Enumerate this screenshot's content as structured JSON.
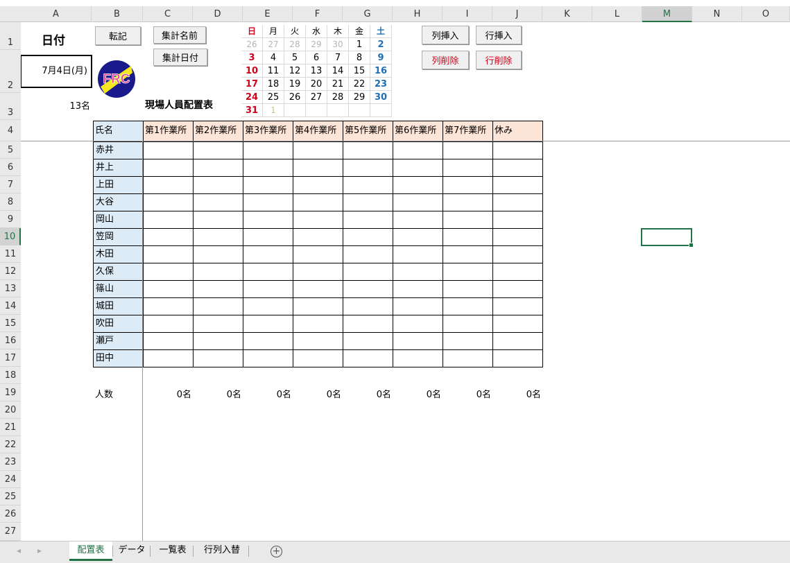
{
  "columns": [
    "A",
    "B",
    "C",
    "D",
    "E",
    "F",
    "G",
    "H",
    "I",
    "J",
    "K",
    "L",
    "M",
    "N",
    "O"
  ],
  "rows": [
    "1",
    "2",
    "3",
    "4",
    "5",
    "6",
    "7",
    "8",
    "9",
    "10",
    "11",
    "12",
    "13",
    "14",
    "15",
    "16",
    "17",
    "18",
    "19",
    "20",
    "21",
    "22",
    "23",
    "24",
    "25",
    "26",
    "27"
  ],
  "header": {
    "date_label": "日付",
    "date_value": "7月4日(月)",
    "total_count": "13名",
    "title": "現場人員配置表"
  },
  "buttons": {
    "transfer": "転記",
    "sum_name": "集計名前",
    "sum_date": "集計日付",
    "col_insert": "列挿入",
    "row_insert": "行挿入",
    "col_delete": "列削除",
    "row_delete": "行削除"
  },
  "logo": {
    "text": "FRC",
    "colors": {
      "ring": "#1a1a8c",
      "yellow": "#f5e71f",
      "text": "#e8368f"
    }
  },
  "calendar": {
    "weekdays": [
      "日",
      "月",
      "火",
      "水",
      "木",
      "金",
      "土"
    ],
    "weeks": [
      [
        {
          "d": "26",
          "t": "gray"
        },
        {
          "d": "27",
          "t": "gray"
        },
        {
          "d": "28",
          "t": "gray"
        },
        {
          "d": "29",
          "t": "gray"
        },
        {
          "d": "30",
          "t": "gray"
        },
        {
          "d": "1",
          "t": "n"
        },
        {
          "d": "2",
          "t": "sat"
        }
      ],
      [
        {
          "d": "3",
          "t": "sun"
        },
        {
          "d": "4",
          "t": "n"
        },
        {
          "d": "5",
          "t": "n"
        },
        {
          "d": "6",
          "t": "n"
        },
        {
          "d": "7",
          "t": "n"
        },
        {
          "d": "8",
          "t": "n"
        },
        {
          "d": "9",
          "t": "sat"
        }
      ],
      [
        {
          "d": "10",
          "t": "sun"
        },
        {
          "d": "11",
          "t": "n"
        },
        {
          "d": "12",
          "t": "n"
        },
        {
          "d": "13",
          "t": "n"
        },
        {
          "d": "14",
          "t": "n"
        },
        {
          "d": "15",
          "t": "n"
        },
        {
          "d": "16",
          "t": "sat"
        }
      ],
      [
        {
          "d": "17",
          "t": "sun"
        },
        {
          "d": "18",
          "t": "n"
        },
        {
          "d": "19",
          "t": "n"
        },
        {
          "d": "20",
          "t": "n"
        },
        {
          "d": "21",
          "t": "n"
        },
        {
          "d": "22",
          "t": "n"
        },
        {
          "d": "23",
          "t": "sat"
        }
      ],
      [
        {
          "d": "24",
          "t": "sun"
        },
        {
          "d": "25",
          "t": "n"
        },
        {
          "d": "26",
          "t": "n"
        },
        {
          "d": "27",
          "t": "n"
        },
        {
          "d": "28",
          "t": "n"
        },
        {
          "d": "29",
          "t": "n"
        },
        {
          "d": "30",
          "t": "sat"
        }
      ],
      [
        {
          "d": "31",
          "t": "sun"
        },
        {
          "d": "1",
          "t": "next"
        },
        {
          "d": "",
          "t": "n"
        },
        {
          "d": "",
          "t": "n"
        },
        {
          "d": "",
          "t": "n"
        },
        {
          "d": "",
          "t": "n"
        },
        {
          "d": "",
          "t": "n"
        }
      ]
    ],
    "colors": {
      "sun": "#d0021b",
      "sat": "#1f6fb5",
      "gray": "#b5b5b5",
      "next": "#c9c38a"
    }
  },
  "table": {
    "name_header": "氏名",
    "site_headers": [
      "第1作業所",
      "第2作業所",
      "第3作業所",
      "第4作業所",
      "第5作業所",
      "第6作業所",
      "第7作業所",
      "休み"
    ],
    "names": [
      "赤井",
      "井上",
      "上田",
      "大谷",
      "岡山",
      "笠岡",
      "木田",
      "久保",
      "篠山",
      "城田",
      "吹田",
      "瀬戸",
      "田中"
    ],
    "count_label": "人数",
    "counts": [
      "0名",
      "0名",
      "0名",
      "0名",
      "0名",
      "0名",
      "0名",
      "0名"
    ]
  },
  "sheet_tabs": [
    "配置表",
    "データ",
    "一覧表",
    "行列入替"
  ],
  "active_tab": "配置表"
}
